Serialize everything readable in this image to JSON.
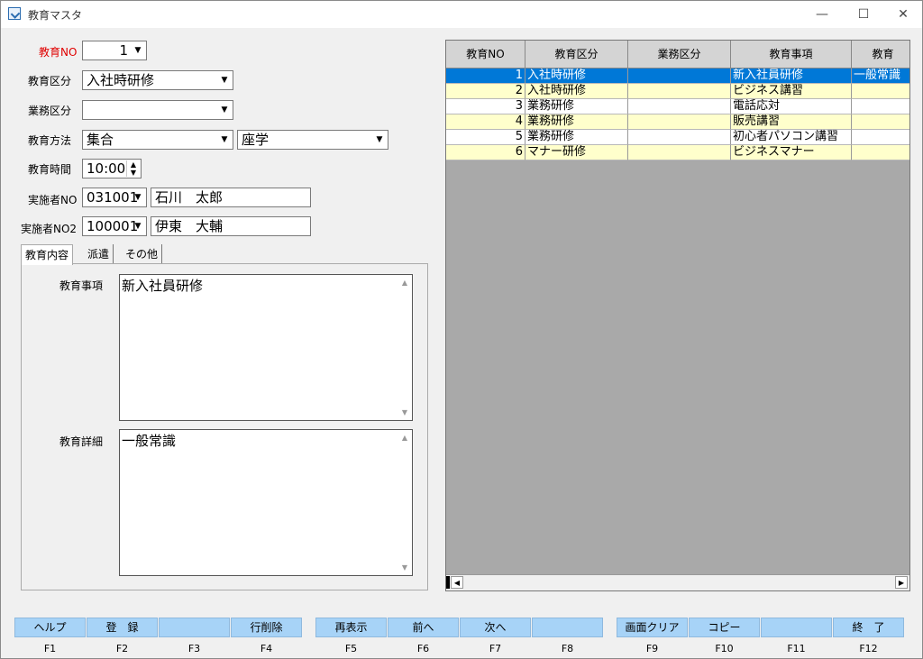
{
  "window": {
    "title": "教育マスタ",
    "minimize": "—",
    "maximize": "☐",
    "close": "✕"
  },
  "form": {
    "no_label": "教育NO",
    "no_value": "1",
    "kubun_label": "教育区分",
    "kubun_value": "入社時研修",
    "gyomu_label": "業務区分",
    "gyomu_value": "",
    "houhou_label": "教育方法",
    "houhou_value1": "集合",
    "houhou_value2": "座学",
    "jikan_label": "教育時間",
    "jikan_value": "10:00",
    "jisshi1_label": "実施者NO",
    "jisshi1_code": "031001",
    "jisshi1_name": "石川　太郎",
    "jisshi2_label": "実施者NO2",
    "jisshi2_code": "100001",
    "jisshi2_name": "伊東　大輔"
  },
  "tabs": [
    {
      "label": "教育内容"
    },
    {
      "label": "派遣"
    },
    {
      "label": "その他"
    }
  ],
  "content": {
    "jikou_label": "教育事項",
    "jikou_value": "新入社員研修",
    "shousai_label": "教育詳細",
    "shousai_value": "一般常識"
  },
  "grid": {
    "headers": [
      "教育NO",
      "教育区分",
      "業務区分",
      "教育事項",
      "教育"
    ],
    "rows": [
      {
        "no": "1",
        "kubun": "入社時研修",
        "gyomu": "",
        "jikou": "新入社員研修",
        "shousai": "一般常識",
        "selected": true
      },
      {
        "no": "2",
        "kubun": "入社時研修",
        "gyomu": "",
        "jikou": "ビジネス講習",
        "shousai": ""
      },
      {
        "no": "3",
        "kubun": "業務研修",
        "gyomu": "",
        "jikou": "電話応対",
        "shousai": ""
      },
      {
        "no": "4",
        "kubun": "業務研修",
        "gyomu": "",
        "jikou": "販売講習",
        "shousai": ""
      },
      {
        "no": "5",
        "kubun": "業務研修",
        "gyomu": "",
        "jikou": "初心者パソコン講習",
        "shousai": ""
      },
      {
        "no": "6",
        "kubun": "マナー研修",
        "gyomu": "",
        "jikou": "ビジネスマナー",
        "shousai": ""
      }
    ]
  },
  "fkeys": [
    {
      "label": "ヘルプ",
      "key": "F1"
    },
    {
      "label": "登　録",
      "key": "F2"
    },
    {
      "label": "",
      "key": "F3"
    },
    {
      "label": "行削除",
      "key": "F4"
    },
    {
      "label": "再表示",
      "key": "F5"
    },
    {
      "label": "前へ",
      "key": "F6"
    },
    {
      "label": "次へ",
      "key": "F7"
    },
    {
      "label": "",
      "key": "F8"
    },
    {
      "label": "画面クリア",
      "key": "F9"
    },
    {
      "label": "コピー",
      "key": "F10"
    },
    {
      "label": "",
      "key": "F11"
    },
    {
      "label": "終　了",
      "key": "F12"
    }
  ],
  "colors": {
    "selected_row": "#0078d7",
    "alt_row": "#ffffcc",
    "fkey": "#a7d3f7",
    "required_label": "#e00000"
  }
}
